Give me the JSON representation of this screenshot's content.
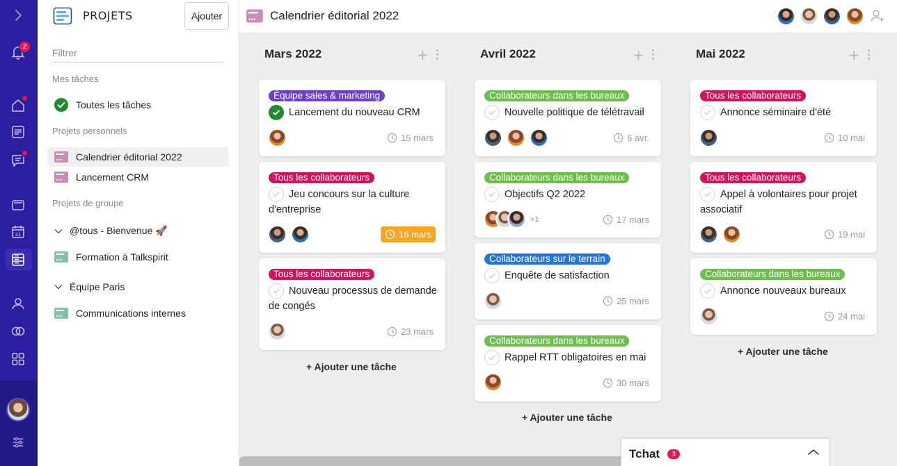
{
  "rail": {
    "notification_count": "2"
  },
  "sidebar": {
    "title": "PROJETS",
    "add_label": "Ajouter",
    "filter_placeholder": "Filtrer",
    "sections": {
      "my_tasks": "Mes tâches",
      "personal": "Projets personnels",
      "group": "Projets de groupe"
    },
    "all_tasks": "Toutes les tâches",
    "personal_projects": [
      "Calendrier éditorial 2022",
      "Lancement CRM"
    ],
    "groups": [
      {
        "name": "@tous - Bienvenue 🚀",
        "projects": [
          "Formation à Talkspirit"
        ]
      },
      {
        "name": "Équipe Paris",
        "projects": [
          "Communications internes"
        ]
      }
    ]
  },
  "topbar": {
    "title": "Calendrier éditorial 2022"
  },
  "colors": {
    "rail": "#2c1ea0",
    "purple_tag": "#6b3fc9",
    "pink_tag": "#d0135c",
    "green_tag": "#6cbf4a",
    "blue_tag": "#2274d8",
    "urgent_date": "#f5a623",
    "done_check": "#1f8a2e"
  },
  "columns": [
    {
      "title": "Mars 2022",
      "add_task": "+ Ajouter une tâche",
      "cards": [
        {
          "tag": "Équipe sales & marketing",
          "title": "Lancement du nouveau CRM",
          "date": "15 mars"
        },
        {
          "tag": "Tous les collaborateurs",
          "title": "Jeu concours sur la culture d'entreprise",
          "date": "16 mars"
        },
        {
          "tag": "Tous les collaborateurs",
          "title": "Nouveau processus de demande de congés",
          "date": "23 mars"
        }
      ]
    },
    {
      "title": "Avril 2022",
      "add_task": "+ Ajouter une tâche",
      "cards": [
        {
          "tag": "Collaborateurs dans les bureaux",
          "title": "Nouvelle politique de télétravail",
          "date": "6 avr."
        },
        {
          "tag": "Collaborateurs dans les bureaux",
          "title": "Objectifs Q2 2022",
          "date": "17 mars",
          "extra": "+1"
        },
        {
          "tag": "Collaborateurs sur le terrain",
          "title": "Enquête de satisfaction",
          "date": "25 mars"
        },
        {
          "tag": "Collaborateurs dans les bureaux",
          "title": "Rappel RTT obligatoires en mai",
          "date": "30 mars"
        }
      ]
    },
    {
      "title": "Mai 2022",
      "add_task": "+ Ajouter une tâche",
      "cards": [
        {
          "tag": "Tous les collaborateurs",
          "title": "Annonce séminaire d'été",
          "date": "10 mai"
        },
        {
          "tag": "Tous les collaborateurs",
          "title": "Appel à volontaires pour projet associatif",
          "date": "19 mai"
        },
        {
          "tag": "Collaborateurs dans les bureaux",
          "title": "Annonce nouveaux bureaux",
          "date": "24 mai"
        }
      ]
    }
  ],
  "chat": {
    "label": "Tchat",
    "count": "3"
  }
}
